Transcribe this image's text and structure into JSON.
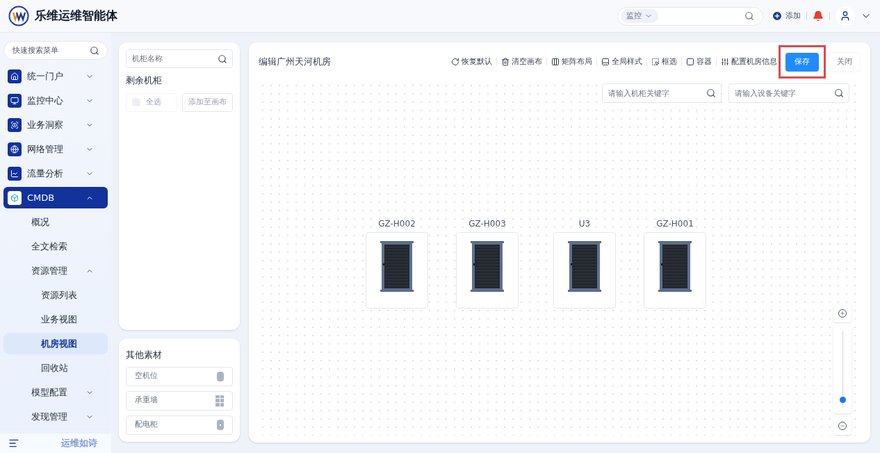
{
  "header": {
    "title": "乐维运维智能体",
    "search": {
      "scope": "监控"
    },
    "add_label": "添加"
  },
  "sidebar": {
    "search": {
      "placeholder": "快速搜索菜单"
    },
    "items": [
      {
        "label": "统一门户",
        "expanded": false,
        "selected": false
      },
      {
        "label": "监控中心",
        "expanded": false,
        "selected": false
      },
      {
        "label": "业务洞察",
        "expanded": false,
        "selected": false
      },
      {
        "label": "网络管理",
        "expanded": false,
        "selected": false
      },
      {
        "label": "流量分析",
        "expanded": false,
        "selected": false
      },
      {
        "label": "CMDB",
        "expanded": true,
        "selected": true,
        "children": [
          {
            "label": "概况",
            "selected": false
          },
          {
            "label": "全文检索",
            "selected": false
          },
          {
            "label": "资源管理",
            "expanded": true,
            "selected": false,
            "children": [
              {
                "label": "资源列表",
                "selected": false
              },
              {
                "label": "业务视图",
                "selected": false
              },
              {
                "label": "机房视图",
                "selected": true
              },
              {
                "label": "回收站",
                "selected": false
              }
            ]
          },
          {
            "label": "模型配置",
            "expanded": false,
            "selected": false
          },
          {
            "label": "发现管理",
            "expanded": false,
            "selected": false
          }
        ]
      }
    ],
    "footer": "运维如诗"
  },
  "cabinet_panel": {
    "search": {
      "placeholder": "机柜名称"
    },
    "title": "剩余机柜",
    "select_all": {
      "label": "全选",
      "checked": false,
      "disabled": true
    },
    "add_button": {
      "label": "添加至画布",
      "disabled": true
    }
  },
  "materials": {
    "title": "其他素材",
    "items": [
      {
        "label": "空机位",
        "kind": "slot"
      },
      {
        "label": "承重墙",
        "kind": "wall"
      },
      {
        "label": "配电柜",
        "kind": "power"
      }
    ]
  },
  "editor": {
    "title": "编辑广州天河机房",
    "toolbar": [
      "恢复默认",
      "清空画布",
      "矩阵布局",
      "全局样式",
      "框选",
      "容器",
      "配置机房信息"
    ],
    "save": "保存",
    "close": "关闭",
    "cabinet_search": {
      "placeholder": "请输入机柜关键字"
    },
    "device_search": {
      "placeholder": "请输入设备关键字"
    },
    "cabinets": [
      {
        "name": "GZ-H002"
      },
      {
        "name": "GZ-H003"
      },
      {
        "name": "U3"
      },
      {
        "name": "GZ-H001"
      }
    ],
    "zoom": {
      "level": 0.1
    }
  }
}
